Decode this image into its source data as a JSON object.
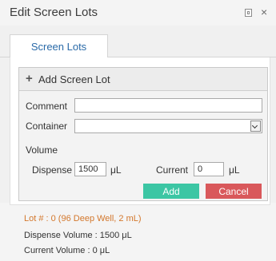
{
  "window": {
    "title": "Edit Screen Lots",
    "pin_icon": "pin-icon",
    "close_icon": "close-icon",
    "close_glyph": "×"
  },
  "tabs": [
    {
      "label": "Screen Lots",
      "active": true
    }
  ],
  "form": {
    "header": {
      "icon": "plus-icon",
      "glyph": "+",
      "label": "Add Screen Lot"
    },
    "comment": {
      "label": "Comment",
      "value": ""
    },
    "container": {
      "label": "Container",
      "value": ""
    },
    "volume": {
      "label": "Volume",
      "dispense_label": "Dispense",
      "dispense_value": "1500",
      "dispense_unit": "μL",
      "current_label": "Current",
      "current_value": "0",
      "current_unit": "μL"
    },
    "buttons": {
      "add": "Add",
      "cancel": "Cancel"
    }
  },
  "lot_summary": {
    "lot": "Lot # : 0 (96 Deep Well, 2 mL)",
    "dispense": "Dispense Volume : 1500 μL",
    "current": "Current Volume : 0 μL"
  },
  "colors": {
    "tab_text": "#2a6aa8",
    "add_button": "#3cc6a4",
    "cancel_button": "#d9585b",
    "lot_title": "#d3772c"
  }
}
